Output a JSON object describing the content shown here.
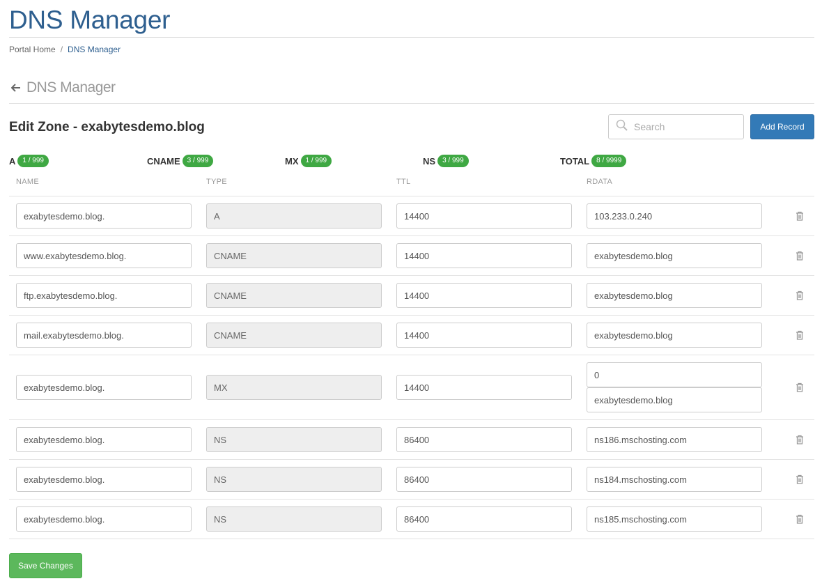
{
  "header": {
    "title": "DNS Manager",
    "breadcrumb": [
      {
        "label": "Portal Home"
      },
      {
        "label": "DNS Manager"
      }
    ],
    "breadcrumb_separator": "/"
  },
  "back": {
    "label": "DNS Manager"
  },
  "zone": {
    "title": "Edit Zone - exabytesdemo.blog"
  },
  "search": {
    "placeholder": "Search"
  },
  "add_record_label": "Add Record",
  "counters": [
    {
      "label": "A",
      "value": "1 / 999"
    },
    {
      "label": "CNAME",
      "value": "3 / 999"
    },
    {
      "label": "MX",
      "value": "1 / 999"
    },
    {
      "label": "NS",
      "value": "3 / 999"
    },
    {
      "label": "TOTAL",
      "value": "8 / 9999"
    }
  ],
  "columns": [
    "NAME",
    "TYPE",
    "TTL",
    "RDATA"
  ],
  "records": [
    {
      "name": "exabytesdemo.blog.",
      "type": "A",
      "ttl": "14400",
      "rdata": [
        "103.233.0.240"
      ]
    },
    {
      "name": "www.exabytesdemo.blog.",
      "type": "CNAME",
      "ttl": "14400",
      "rdata": [
        "exabytesdemo.blog"
      ]
    },
    {
      "name": "ftp.exabytesdemo.blog.",
      "type": "CNAME",
      "ttl": "14400",
      "rdata": [
        "exabytesdemo.blog"
      ]
    },
    {
      "name": "mail.exabytesdemo.blog.",
      "type": "CNAME",
      "ttl": "14400",
      "rdata": [
        "exabytesdemo.blog"
      ]
    },
    {
      "name": "exabytesdemo.blog.",
      "type": "MX",
      "ttl": "14400",
      "rdata": [
        "0",
        "exabytesdemo.blog"
      ]
    },
    {
      "name": "exabytesdemo.blog.",
      "type": "NS",
      "ttl": "86400",
      "rdata": [
        "ns186.mschosting.com"
      ]
    },
    {
      "name": "exabytesdemo.blog.",
      "type": "NS",
      "ttl": "86400",
      "rdata": [
        "ns184.mschosting.com"
      ]
    },
    {
      "name": "exabytesdemo.blog.",
      "type": "NS",
      "ttl": "86400",
      "rdata": [
        "ns185.mschosting.com"
      ]
    }
  ],
  "save_label": "Save Changes",
  "icons": {
    "back": "arrow-left-icon",
    "search": "magnifier-icon",
    "delete": "trash-icon"
  },
  "colors": {
    "title": "#2e5f8f",
    "primary_button": "#337ab7",
    "success_button": "#5cb85c",
    "badge": "#3fa843"
  }
}
